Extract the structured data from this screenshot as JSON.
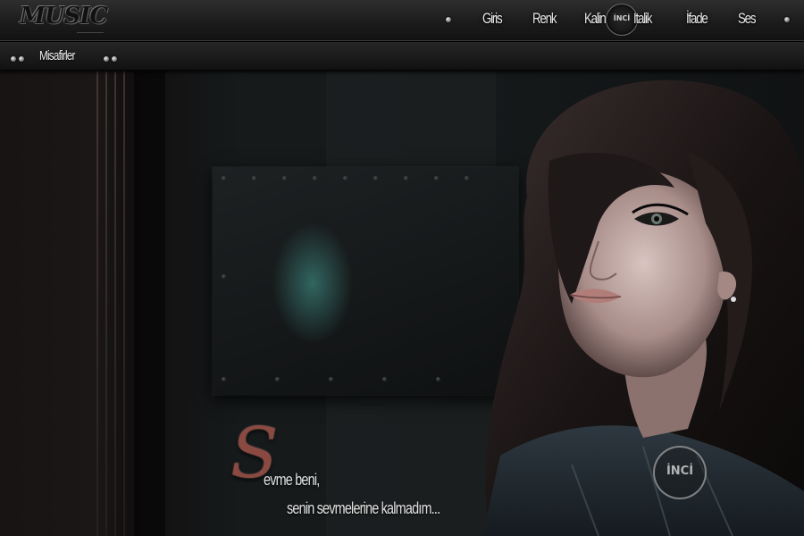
{
  "header": {
    "logo_text": "MUSIC",
    "nav": [
      {
        "label": "Giris"
      },
      {
        "label": "Renk"
      },
      {
        "label": "Kalin"
      },
      {
        "label": "Italik"
      },
      {
        "label": "İfade"
      },
      {
        "label": "Ses"
      }
    ],
    "nav_badge_text": "İNCİ"
  },
  "subnav": {
    "guests_label": "Misafirler"
  },
  "quote": {
    "initial": "S",
    "line1": "evme beni,",
    "line2": "senin sevmelerine kalmadım..."
  },
  "watermark": {
    "text": "İNCİ"
  },
  "colors": {
    "background": "#0c0e0f",
    "bar": "#1c1c1c",
    "nav_text": "#e8e8e8",
    "quote_initial": "#8a4a42",
    "panel_glow": "#46a096"
  }
}
